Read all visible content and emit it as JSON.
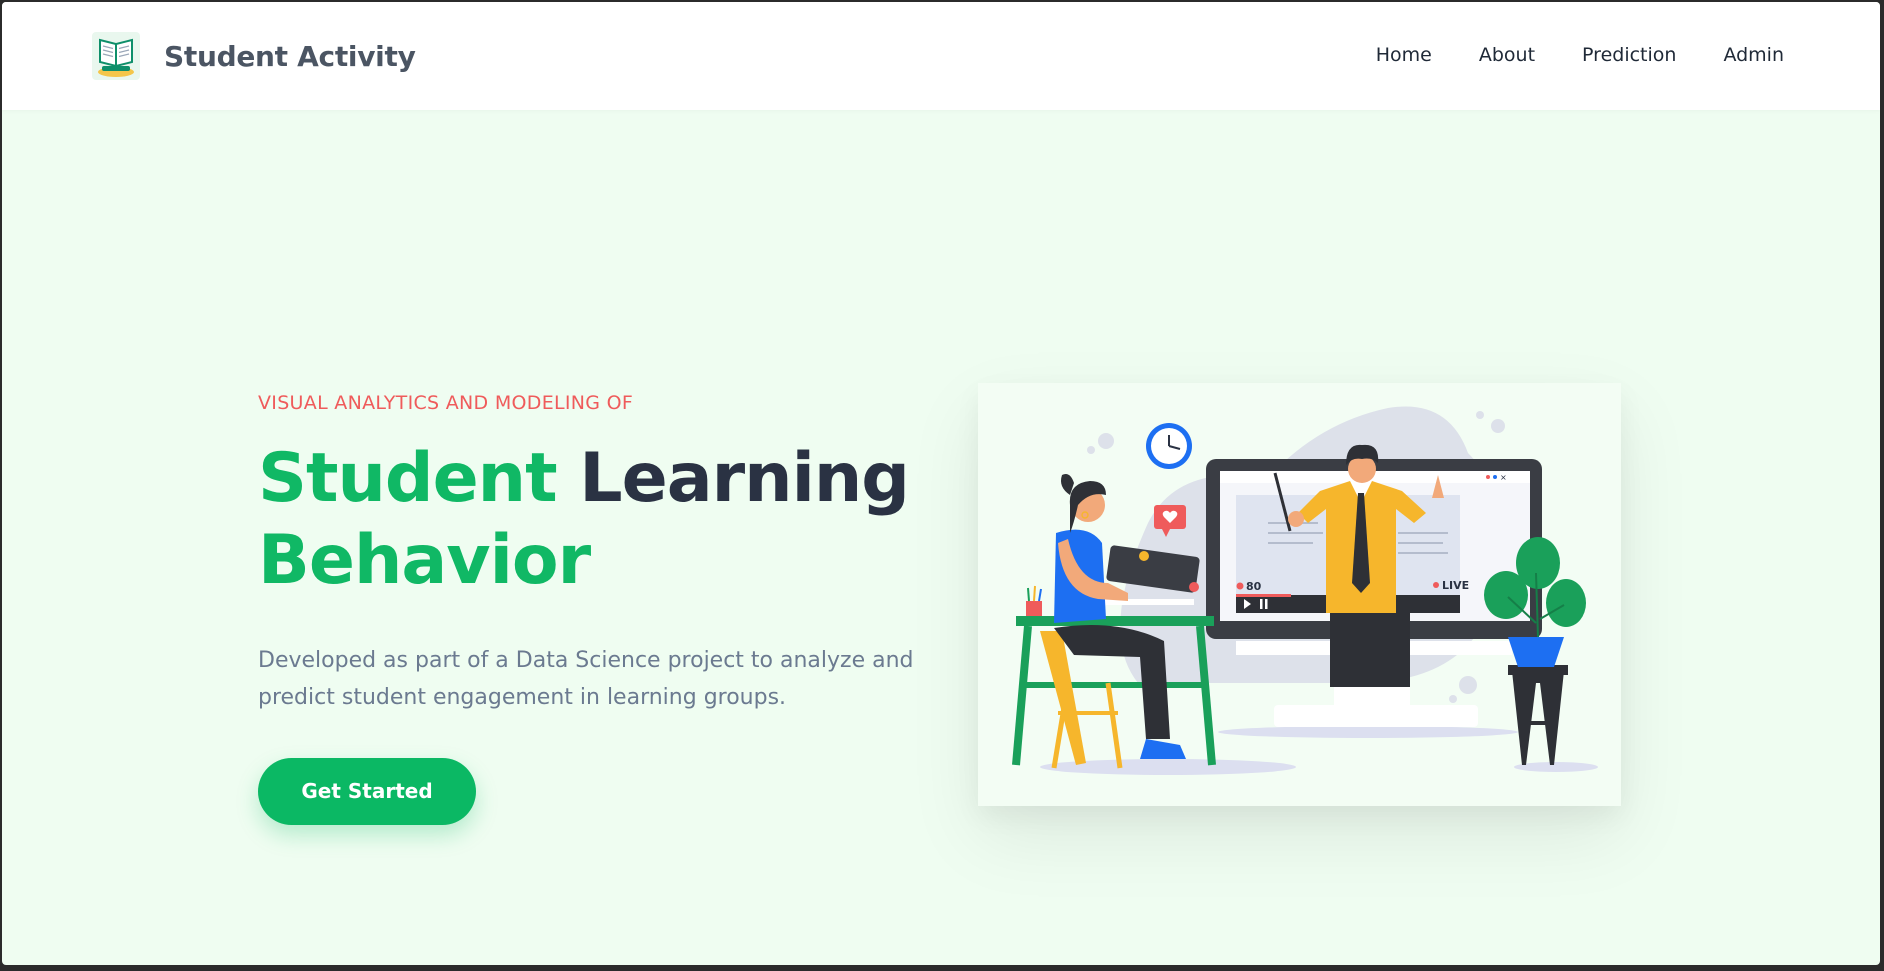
{
  "brand": {
    "name": "Student Activity",
    "logo_icon": "open-book-icon"
  },
  "nav": {
    "items": [
      {
        "label": "Home"
      },
      {
        "label": "About"
      },
      {
        "label": "Prediction"
      },
      {
        "label": "Admin"
      }
    ]
  },
  "hero": {
    "eyebrow": "VISUAL ANALYTICS AND MODELING OF",
    "title_part1": "Student",
    "title_part2": "Learning",
    "title_part3": "Behavior",
    "description": "Developed as part of a Data Science project to analyze and predict student engagement in learning groups.",
    "cta_label": "Get Started"
  },
  "illustration": {
    "viewer_count": "80",
    "live_label": "LIVE"
  },
  "colors": {
    "primary_green": "#10b865",
    "dark_text": "#2a3243",
    "eyebrow_red": "#ef5b5b",
    "page_bg": "#effdf1"
  }
}
